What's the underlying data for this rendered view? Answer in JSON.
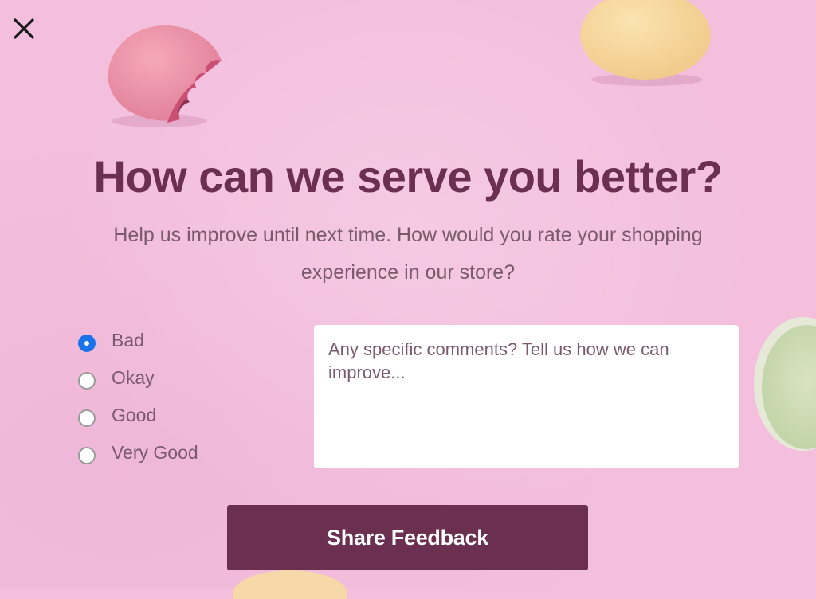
{
  "dialog": {
    "close_icon": "close-icon"
  },
  "content": {
    "headline": "How can we serve you better?",
    "subtitle": "Help us improve until next time. How would you rate your shopping experience in our store?"
  },
  "rating": {
    "selected": "Bad",
    "options": [
      {
        "label": "Bad",
        "checked": true
      },
      {
        "label": "Okay",
        "checked": false
      },
      {
        "label": "Good",
        "checked": false
      },
      {
        "label": "Very Good",
        "checked": false
      }
    ]
  },
  "comments": {
    "value": "",
    "placeholder": "Any specific comments? Tell us how we can improve..."
  },
  "submit": {
    "label": "Share Feedback"
  },
  "colors": {
    "background": "#f3bfdd",
    "accent": "#6b2f4f",
    "text_muted": "#7a5a6c",
    "radio_selected": "#1a73e8"
  }
}
